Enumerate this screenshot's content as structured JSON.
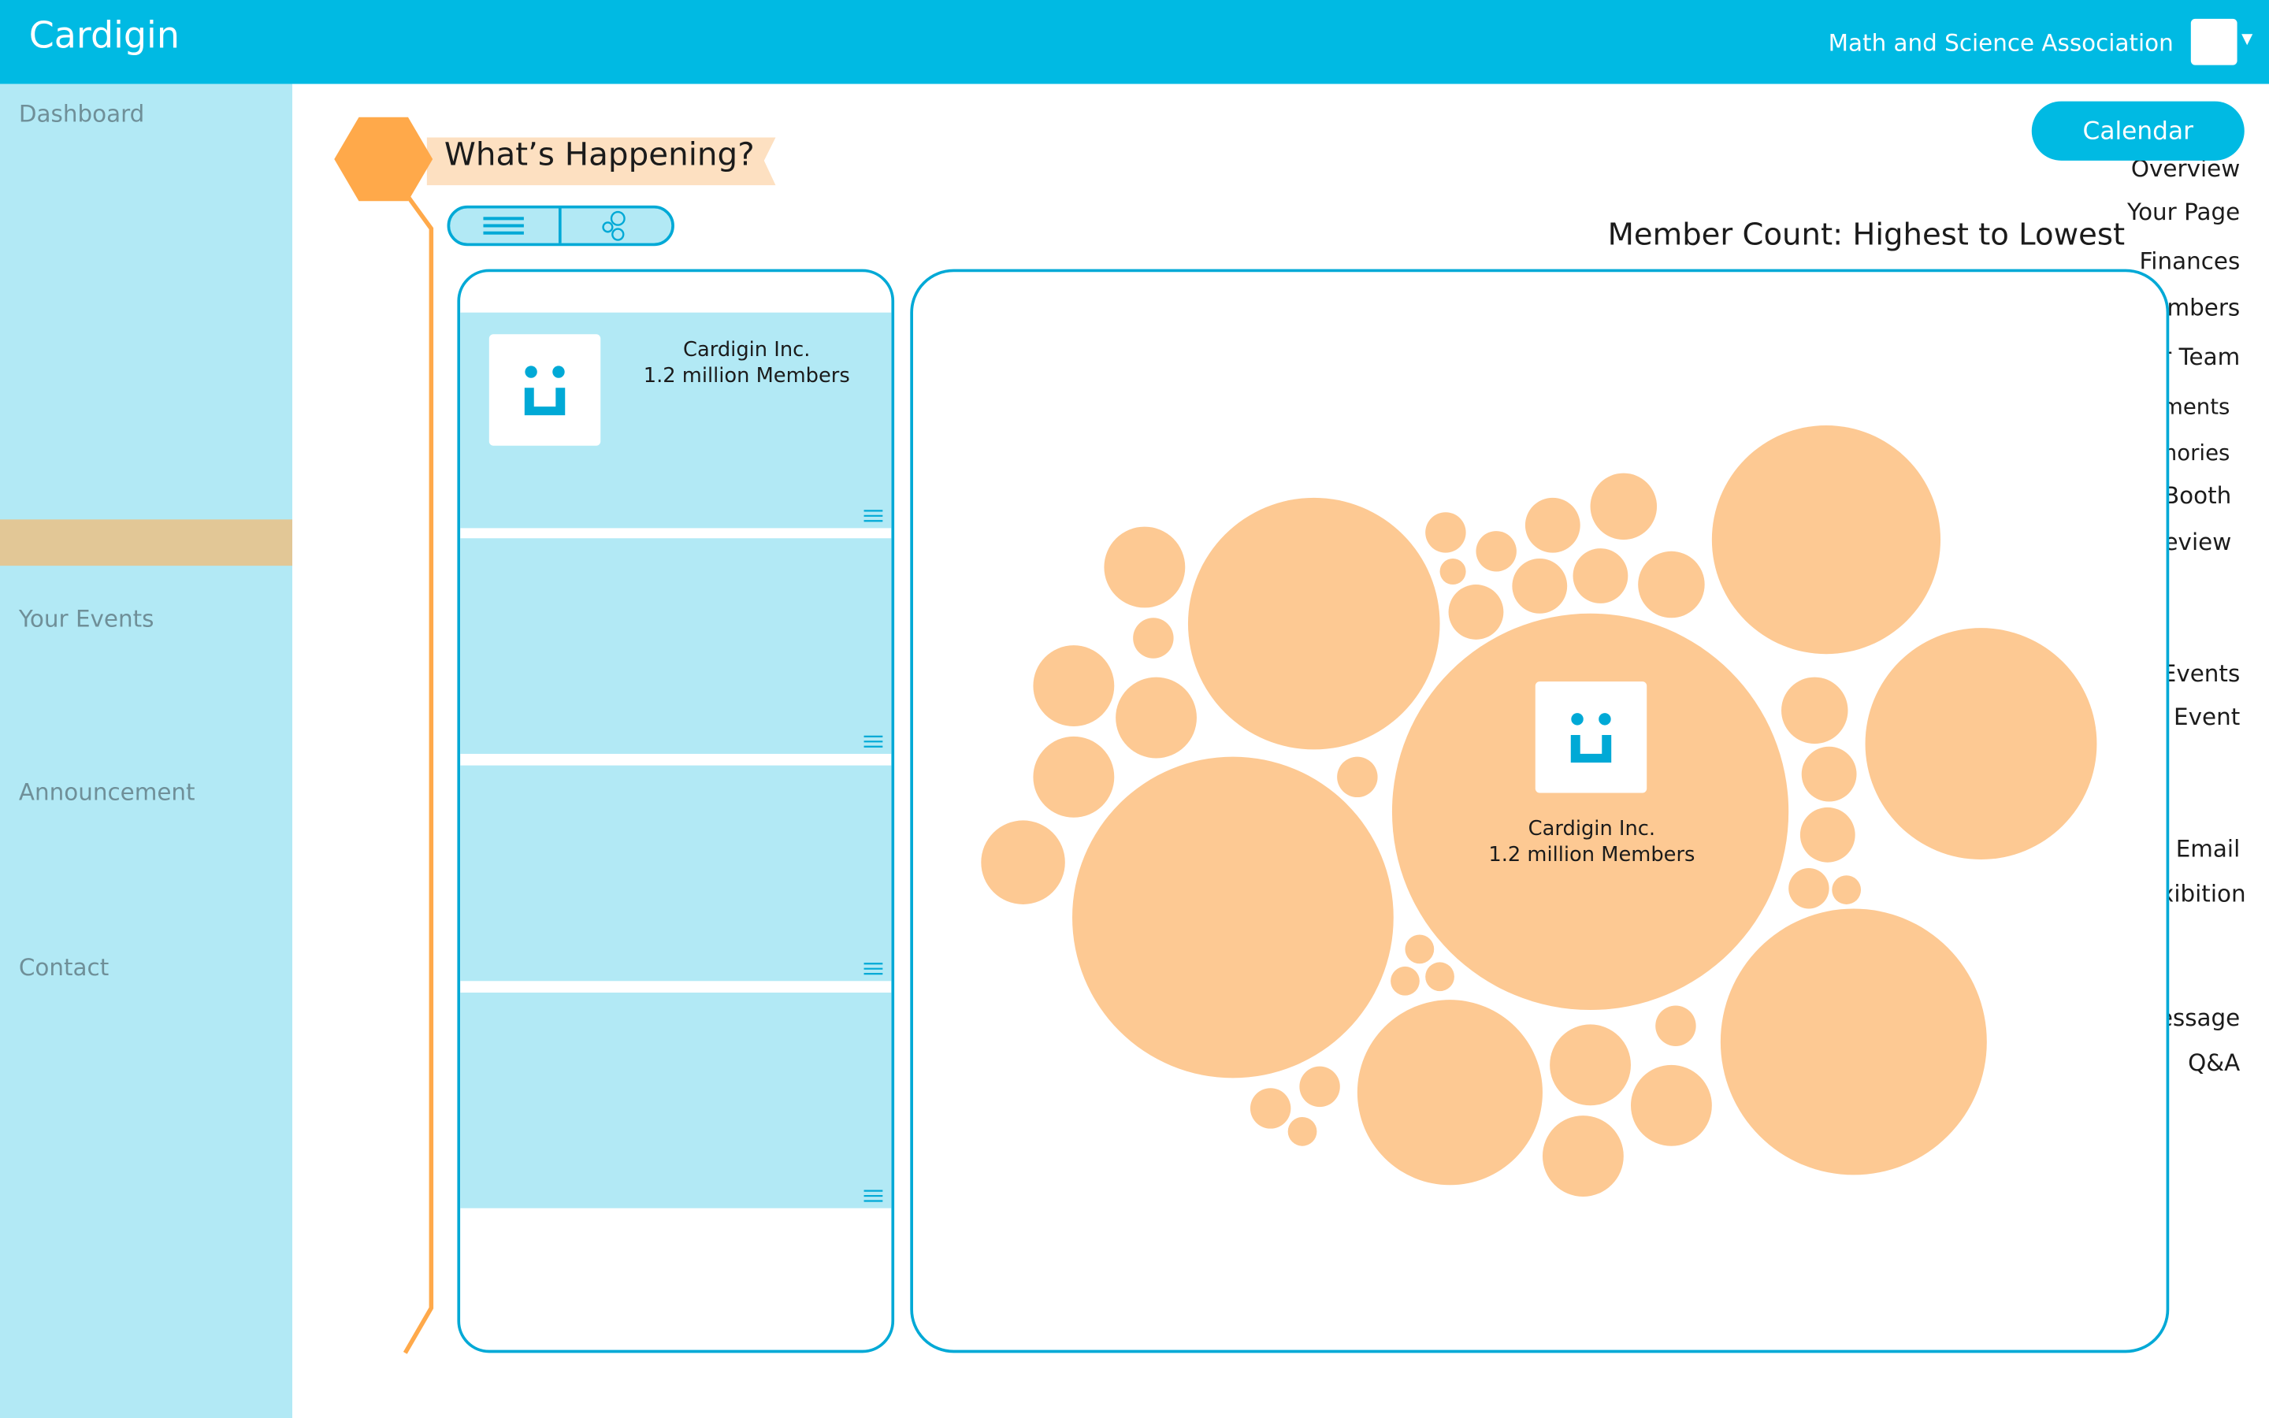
{
  "app": {
    "title": "Cardigin"
  },
  "header": {
    "org_name": "Math and Science Association",
    "avatar_menu_icon": "caret-down-icon"
  },
  "sidebar": {
    "sections": [
      {
        "heading": "Dashboard",
        "items": [
          "Overview",
          "Your Page",
          "Finances",
          "Members",
          "Your Team",
          "Documents",
          "Memories",
          "Voting Booth",
          "Club Review"
        ]
      },
      {
        "heading": "Your Events",
        "items": [
          "All Events",
          "Create Event"
        ]
      },
      {
        "heading": "Announcement",
        "items": [
          "Send Email",
          "Exibition"
        ]
      },
      {
        "heading": "Contact",
        "items": [
          "Message",
          "Q&A"
        ]
      }
    ],
    "active_item": "Club Review"
  },
  "main": {
    "calendar_button": "Calendar",
    "section_title": "What’s Happening?",
    "view_toggle": {
      "list_icon": "list-icon",
      "bubble_icon": "bubbles-icon",
      "selected": "list"
    },
    "sort_label": "Member Count: Highest to Lowest"
  },
  "list": {
    "cards": [
      {
        "name": "Cardigin Inc.",
        "members": "1.2 million Members"
      },
      {
        "name": "",
        "members": ""
      },
      {
        "name": "",
        "members": ""
      },
      {
        "name": "",
        "members": ""
      }
    ]
  },
  "bubble_chart": {
    "featured": {
      "name": "Cardigin Inc.",
      "members": "1.2 million Members"
    }
  },
  "colors": {
    "primary": "#00bae3",
    "sidebar": "#b2e9f5",
    "active": "#e2c796",
    "bubble": "#fdc993",
    "accent": "#ffa94a"
  }
}
